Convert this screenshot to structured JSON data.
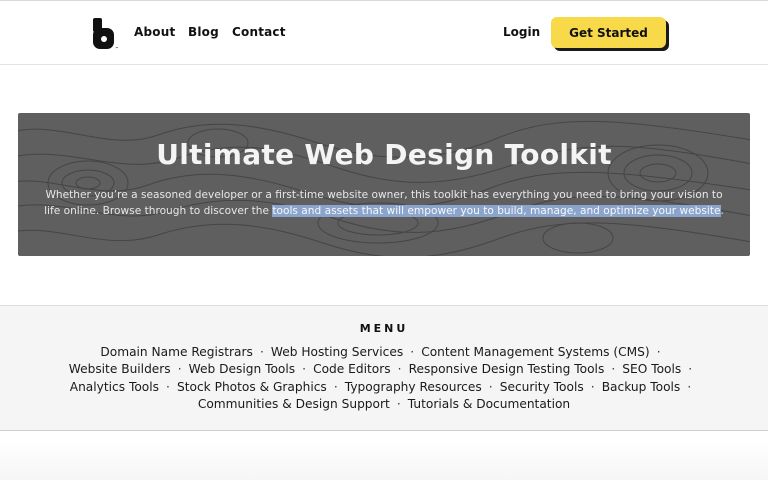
{
  "header": {
    "logo_icon": "brand-logo-icon",
    "nav": [
      {
        "label": "About"
      },
      {
        "label": "Blog"
      },
      {
        "label": "Contact"
      }
    ],
    "login_label": "Login",
    "cta_label": "Get Started",
    "cta_color": "#f7d94a"
  },
  "hero": {
    "title": "Ultimate Web Design Toolkit",
    "text_plain": "Whether you’re a seasoned developer or a first-time website owner, this toolkit has everything you need to bring your vision to life online. Browse through to discover the ",
    "text_selected": "tools and assets that will empower you to build, manage, and optimize your website",
    "text_end": ".",
    "background_color": "#5f5f5f",
    "selection_color": "#8aa4cc"
  },
  "menu": {
    "heading": "MENU",
    "separator": "·",
    "lines": [
      [
        "Domain Name Registrars",
        "Web Hosting Services",
        "Content Management Systems (CMS)"
      ],
      [
        "Website Builders",
        "Web Design Tools",
        "Code Editors",
        "Responsive Design Testing Tools",
        "SEO Tools"
      ],
      [
        "Analytics Tools",
        "Stock Photos & Graphics",
        "Typography Resources",
        "Security Tools",
        "Backup Tools"
      ],
      [
        "Communities & Design Support",
        "Tutorials & Documentation"
      ]
    ]
  }
}
